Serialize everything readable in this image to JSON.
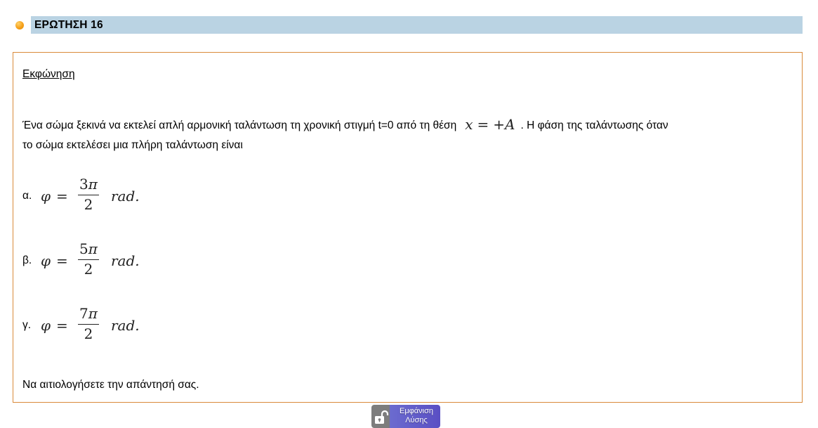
{
  "question": {
    "title": "ΕΡΩΤΗΣΗ 16",
    "statement_label": "Εκφώνηση",
    "line1_text": "Ένα σώμα ξεκινά να εκτελεί απλή αρμονική ταλάντωση τη χρονική στιγμή t=0 από τη θέση",
    "position_math": {
      "var": "x",
      "eq": "=",
      "value": "+A"
    },
    "line1_tail": ". Η φάση της ταλάντωσης όταν",
    "line2_text": "το σώμα εκτελέσει μια πλήρη ταλάντωση είναι",
    "options": [
      {
        "letter": "α.",
        "symbol": "φ",
        "eq": "=",
        "num": "3",
        "pi": "π",
        "den": "2",
        "unit": "rad."
      },
      {
        "letter": "β.",
        "symbol": "φ",
        "eq": "=",
        "num": "5",
        "pi": "π",
        "den": "2",
        "unit": "rad."
      },
      {
        "letter": "γ.",
        "symbol": "φ",
        "eq": "=",
        "num": "7",
        "pi": "π",
        "den": "2",
        "unit": "rad."
      }
    ],
    "closing": "Να αιτιολογήσετε την απάντησή σας."
  },
  "solution_button": {
    "line1": "Εμφάνιση",
    "line2": "Λύσης",
    "icon": "unlock-icon"
  },
  "colors": {
    "header_bar": "#bad3e3",
    "box_border": "#d98a3a",
    "bullet": "#f6a01a",
    "button": "#5a4fc4"
  }
}
